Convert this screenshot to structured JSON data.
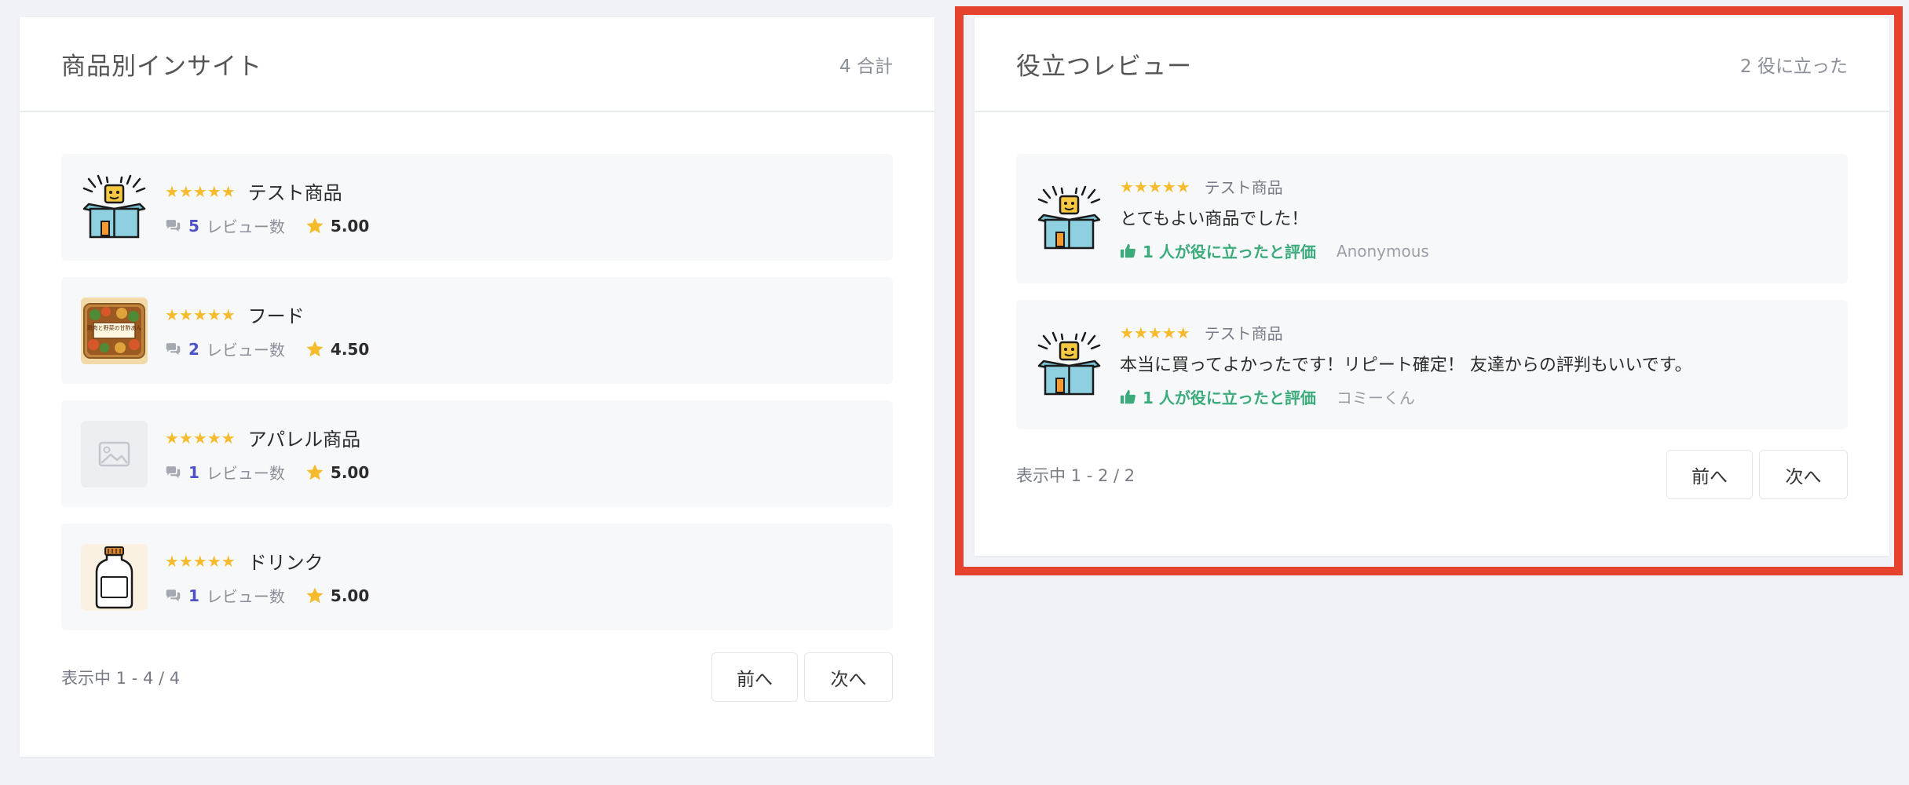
{
  "insights": {
    "title": "商品別インサイト",
    "count": "4 合計",
    "review_label": "レビュー数",
    "stars": "★★★★★",
    "items": [
      {
        "name": "テスト商品",
        "reviews": "5",
        "avg": "5.00",
        "thumb": "box-icon"
      },
      {
        "name": "フード",
        "reviews": "2",
        "avg": "4.50",
        "thumb": "food-photo"
      },
      {
        "name": "アパレル商品",
        "reviews": "1",
        "avg": "5.00",
        "thumb": "image-placeholder-icon"
      },
      {
        "name": "ドリンク",
        "reviews": "1",
        "avg": "5.00",
        "thumb": "bottle-icon"
      }
    ],
    "pager": {
      "text": "表示中 1 - 4 / 4",
      "prev": "前へ",
      "next": "次へ"
    }
  },
  "helpful": {
    "title": "役立つレビュー",
    "count": "2 役に立った",
    "stars": "★★★★★",
    "items": [
      {
        "product": "テスト商品",
        "text": "とてもよい商品でした！",
        "helpful": "1 人が役に立ったと評価",
        "author": "Anonymous"
      },
      {
        "product": "テスト商品",
        "text": "本当に買ってよかったです！リピート確定！ 友達からの評判もいいです。",
        "helpful": "1 人が役に立ったと評価",
        "author": "コミーくん"
      }
    ],
    "pager": {
      "text": "表示中 1 - 2 / 2",
      "prev": "前へ",
      "next": "次へ"
    }
  },
  "colors": {
    "highlight": "#e5432e",
    "star": "#f6bb2d",
    "count_accent": "#4f52c7",
    "helpful_accent": "#3cab7b"
  },
  "food_label": "鶏肉と野菜の甘酢あん"
}
